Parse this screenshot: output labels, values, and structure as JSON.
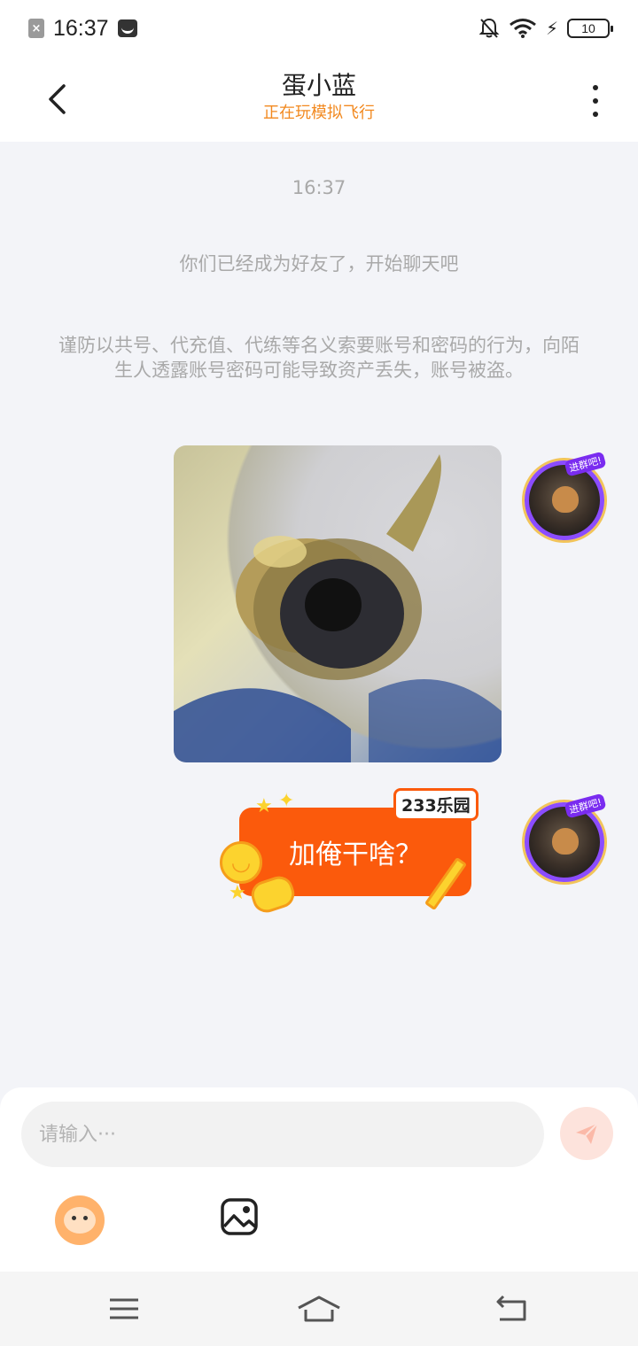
{
  "status_bar": {
    "time": "16:37",
    "battery": "10"
  },
  "header": {
    "title": "蛋小蓝",
    "subtitle": "正在玩模拟飞行"
  },
  "messages": {
    "timestamp": "16:37",
    "system_text": "你们已经成为好友了，开始聊天吧",
    "warning_text": "谨防以共号、代充值、代练等名义索要账号和密码的行为，向陌生人透露账号密码可能导致资产丢失，账号被盗。",
    "sticker_text": "加俺干啥？",
    "sticker_logo": "233乐园",
    "avatar_badge": "进群吧!"
  },
  "input": {
    "placeholder": "请输入···"
  },
  "icons": {
    "back": "chevron-left-icon",
    "more": "more-vertical-icon",
    "send": "paper-plane-icon",
    "emoji": "emoji-icon",
    "image": "image-icon",
    "nav_menu": "menu-icon",
    "nav_home": "home-icon",
    "nav_back": "back-icon"
  },
  "colors": {
    "accent": "#f2891f",
    "sticker_orange": "#fb5a0c",
    "send_button": "#fde3dc",
    "background": "#f3f4f8"
  }
}
